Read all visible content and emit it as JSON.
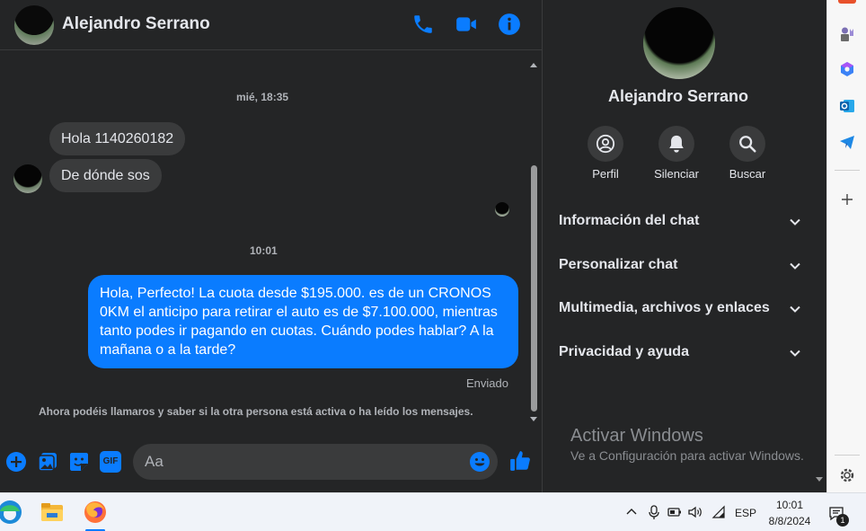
{
  "contact": {
    "name": "Alejandro Serrano"
  },
  "header": {
    "icons": [
      "phone-icon",
      "video-camera-icon",
      "info-icon"
    ]
  },
  "messages": {
    "timestamp_1": "mié, 18:35",
    "incoming": [
      "Hola 1140260182",
      "De dónde sos"
    ],
    "timestamp_2": "10:01",
    "outgoing": "Hola, Perfecto! La cuota desde $195.000. es de un CRONOS 0KM el anticipo para retirar el auto es de $7.100.000, mientras tanto podes ir pagando en cuotas. Cuándo podes hablar? A la mañana o a la tarde?",
    "status": "Enviado",
    "notice": "Ahora podéis llamaros y saber si la otra persona está activa o ha leído los mensajes."
  },
  "composer": {
    "placeholder": "Aa",
    "gif_label": "GIF"
  },
  "info_panel": {
    "name": "Alejandro Serrano",
    "actions": [
      {
        "label": "Perfil",
        "icon": "profile-icon"
      },
      {
        "label": "Silenciar",
        "icon": "bell-icon"
      },
      {
        "label": "Buscar",
        "icon": "search-icon"
      }
    ],
    "sections": [
      "Información del chat",
      "Personalizar chat",
      "Multimedia, archivos y enlaces",
      "Privacidad y ayuda"
    ]
  },
  "watermark": {
    "title": "Activar Windows",
    "subtitle": "Ve a Configuración para activar Windows."
  },
  "taskbar": {
    "language": "ESP",
    "time": "10:01",
    "date": "8/8/2024",
    "notification_count": "1"
  },
  "colors": {
    "accent": "#0a7cff",
    "background": "#242526",
    "bubble_incoming": "#3a3b3c"
  }
}
